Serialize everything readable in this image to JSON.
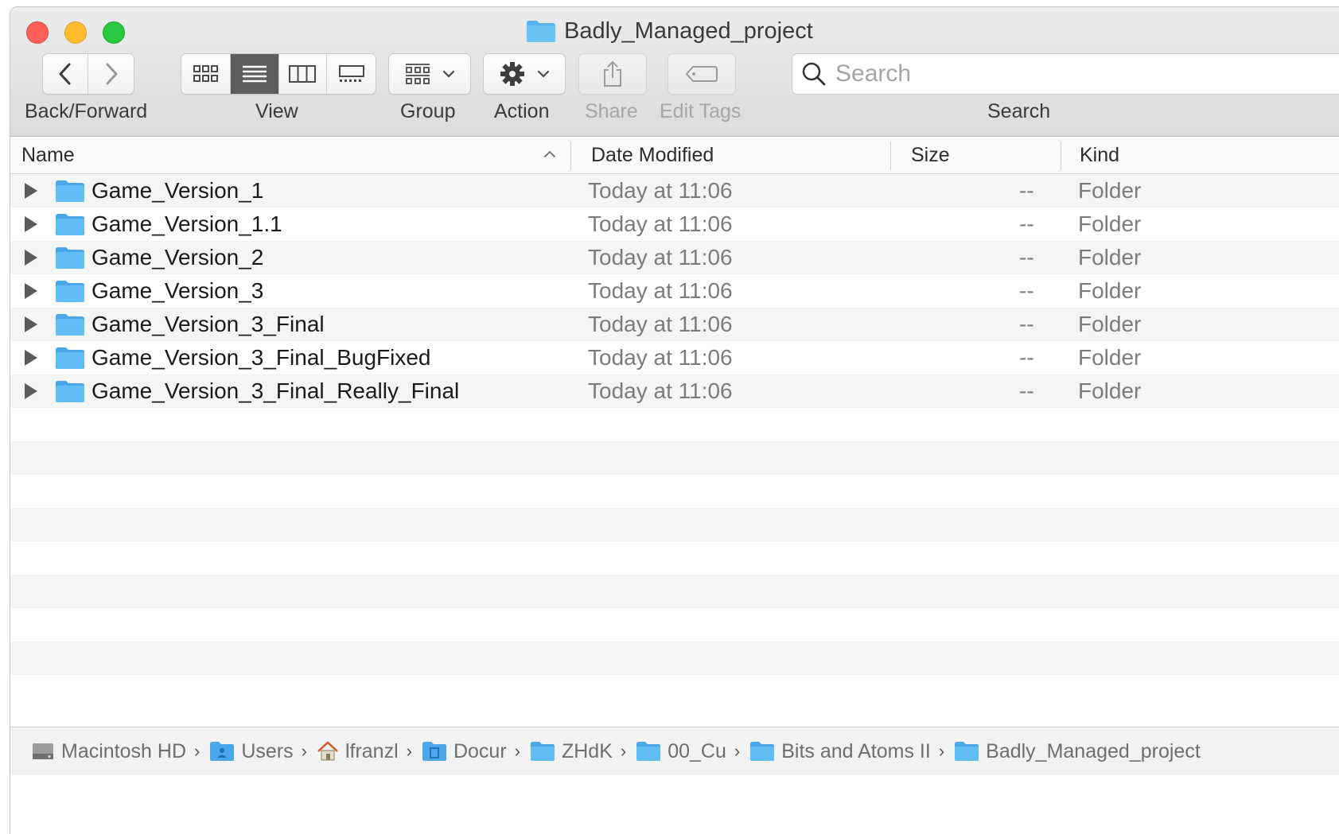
{
  "window": {
    "title": "Badly_Managed_project"
  },
  "toolbar": {
    "back_forward_label": "Back/Forward",
    "view_label": "View",
    "group_label": "Group",
    "action_label": "Action",
    "share_label": "Share",
    "edit_tags_label": "Edit Tags",
    "search_label": "Search",
    "search_placeholder": "Search"
  },
  "columns": {
    "name": "Name",
    "date_modified": "Date Modified",
    "size": "Size",
    "kind": "Kind"
  },
  "files": [
    {
      "name": "Game_Version_1",
      "date": "Today at 11:06",
      "size": "--",
      "kind": "Folder"
    },
    {
      "name": "Game_Version_1.1",
      "date": "Today at 11:06",
      "size": "--",
      "kind": "Folder"
    },
    {
      "name": "Game_Version_2",
      "date": "Today at 11:06",
      "size": "--",
      "kind": "Folder"
    },
    {
      "name": "Game_Version_3",
      "date": "Today at 11:06",
      "size": "--",
      "kind": "Folder"
    },
    {
      "name": "Game_Version_3_Final",
      "date": "Today at 11:06",
      "size": "--",
      "kind": "Folder"
    },
    {
      "name": "Game_Version_3_Final_BugFixed",
      "date": "Today at 11:06",
      "size": "--",
      "kind": "Folder"
    },
    {
      "name": "Game_Version_3_Final_Really_Final",
      "date": "Today at 11:06",
      "size": "--",
      "kind": "Folder"
    }
  ],
  "path": [
    {
      "label": "Macintosh HD",
      "icon": "hard-drive-icon"
    },
    {
      "label": "Users",
      "icon": "users-folder-icon"
    },
    {
      "label": "lfranzl",
      "icon": "home-icon"
    },
    {
      "label": "Docur",
      "icon": "documents-folder-icon"
    },
    {
      "label": "ZHdK",
      "icon": "folder-icon"
    },
    {
      "label": "00_Cu",
      "icon": "folder-icon"
    },
    {
      "label": "Bits and Atoms II",
      "icon": "folder-icon"
    },
    {
      "label": "Badly_Managed_project",
      "icon": "folder-icon"
    }
  ],
  "colors": {
    "folder_blue": "#5ab4f0",
    "active_view": "#5d5d5d",
    "close": "#fe5f57",
    "minimize": "#febc2e",
    "zoom": "#28c840"
  }
}
